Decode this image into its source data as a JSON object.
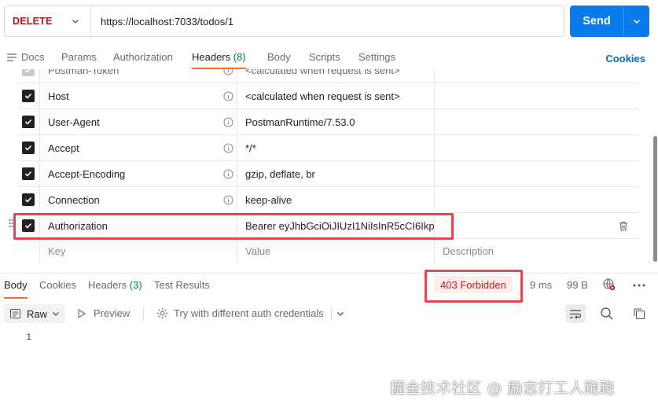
{
  "request": {
    "method": "DELETE",
    "url": "https://localhost:7033/todos/1",
    "send_label": "Send"
  },
  "request_tabs": [
    {
      "label": "Docs"
    },
    {
      "label": "Params"
    },
    {
      "label": "Authorization"
    },
    {
      "label": "Headers",
      "count": "(8)"
    },
    {
      "label": "Body"
    },
    {
      "label": "Scripts"
    },
    {
      "label": "Settings"
    }
  ],
  "cookies_label": "Cookies",
  "headers": [
    {
      "key": "Postman-Token",
      "value": "<calculated when request is sent>"
    },
    {
      "key": "Host",
      "value": "<calculated when request is sent>"
    },
    {
      "key": "User-Agent",
      "value": "PostmanRuntime/7.53.0"
    },
    {
      "key": "Accept",
      "value": "*/*"
    },
    {
      "key": "Accept-Encoding",
      "value": "gzip, deflate, br"
    },
    {
      "key": "Connection",
      "value": "keep-alive"
    },
    {
      "key": "Authorization",
      "value": "Bearer eyJhbGciOiJIUzI1NiIsInR5cCI6Ikp..."
    }
  ],
  "new_row": {
    "key_placeholder": "Key",
    "value_placeholder": "Value",
    "description_placeholder": "Description"
  },
  "response_tabs": [
    {
      "label": "Body"
    },
    {
      "label": "Cookies"
    },
    {
      "label": "Headers",
      "count": "(3)"
    },
    {
      "label": "Test Results"
    }
  ],
  "response": {
    "status": "403 Forbidden",
    "time": "9 ms",
    "size": "99 B"
  },
  "toolbar": {
    "format_label": "Raw",
    "preview_label": "Preview",
    "auth_label": "Try with different auth credentials"
  },
  "editor": {
    "line_number": "1"
  },
  "watermark": "掘金技术社区 @ 励志打工人跑跑",
  "colors": {
    "accent": "#097bed",
    "tab_underline": "#ff6c37",
    "method": "#a61b1b",
    "highlight": "#e5474f",
    "status_bg": "#fdecec"
  }
}
